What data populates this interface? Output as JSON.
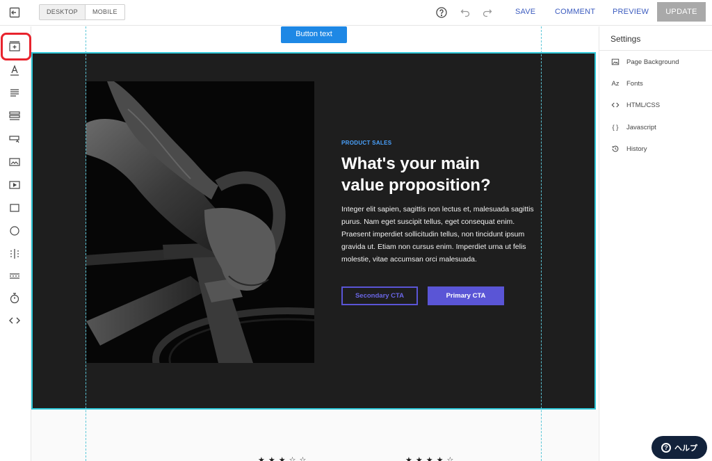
{
  "toolbar": {
    "device_options": [
      "DESKTOP",
      "MOBILE"
    ],
    "save_label": "SAVE",
    "comment_label": "COMMENT",
    "preview_label": "PREVIEW",
    "update_label": "UPDATE",
    "icons": [
      "exit-editor-icon",
      "help-circle-icon",
      "undo-icon",
      "redo-icon"
    ]
  },
  "sidebar": {
    "tools": [
      "add-section-icon",
      "text-icon",
      "paragraph-icon",
      "list-icon",
      "form-icon",
      "image-icon",
      "video-icon",
      "box-icon",
      "circle-icon",
      "columns-icon",
      "divider-icon",
      "timer-icon",
      "code-icon"
    ]
  },
  "canvas": {
    "button_text": "Button text",
    "hero": {
      "eyebrow": "PRODUCT SALES",
      "headline_line1": "What's your main",
      "headline_line2": "value proposition?",
      "body": "Integer elit sapien, sagittis non lectus et, malesuada sagittis purus. Nam eget suscipit tellus, eget consequat enim. Praesent imperdiet sollicitudin tellus, non tincidunt ipsum gravida ut. Etiam non cursus enim. Imperdiet urna ut felis molestie, vitae accumsan orci malesuada.",
      "secondary_cta": "Secondary CTA",
      "primary_cta": "Primary CTA"
    },
    "stars_left": "★★★☆☆",
    "stars_right": "★★★★☆"
  },
  "settings": {
    "title": "Settings",
    "items": [
      {
        "label": "Page Background",
        "icon": "image-icon"
      },
      {
        "label": "Fonts",
        "icon": "fonts-icon"
      },
      {
        "label": "HTML/CSS",
        "icon": "code-icon"
      },
      {
        "label": "Javascript",
        "icon": "braces-icon"
      },
      {
        "label": "History",
        "icon": "history-icon"
      }
    ]
  },
  "help": {
    "label": "ヘルプ"
  },
  "colors": {
    "accent": "#1e88e5",
    "cta": "#5a55d6",
    "highlight": "#e8232d",
    "selection": "#2ec7d8",
    "link": "#3b5bbf"
  }
}
